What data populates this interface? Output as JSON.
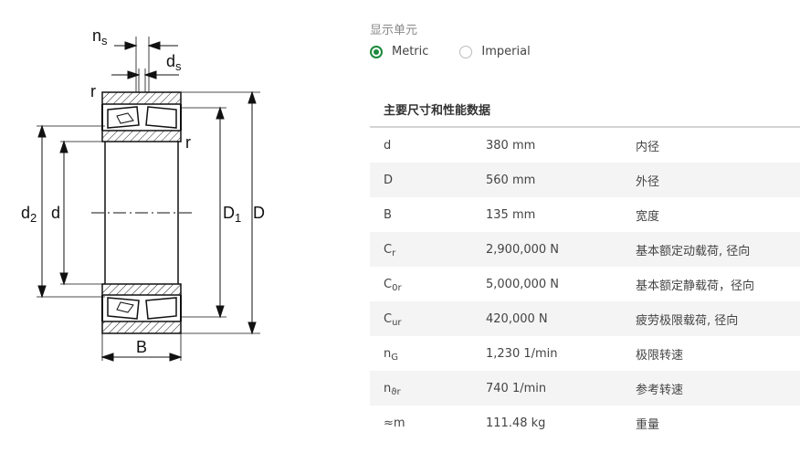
{
  "drawing": {
    "labels": {
      "ns": {
        "main": "n",
        "sub": "s"
      },
      "ds": {
        "main": "d",
        "sub": "s"
      },
      "r_top": "r",
      "r_right": "r",
      "d2": {
        "main": "d",
        "sub": "2"
      },
      "d": "d",
      "D1": {
        "main": "D",
        "sub": "1"
      },
      "D": "D",
      "B": "B"
    }
  },
  "units": {
    "label": "显示单元",
    "options": [
      {
        "label": "Metric",
        "selected": true
      },
      {
        "label": "Imperial",
        "selected": false
      }
    ]
  },
  "section_title": "主要尺寸和性能数据",
  "rows": [
    {
      "sym": "d",
      "sub": "",
      "value": "380 mm",
      "desc": "内径"
    },
    {
      "sym": "D",
      "sub": "",
      "value": "560 mm",
      "desc": "外径"
    },
    {
      "sym": "B",
      "sub": "",
      "value": "135 mm",
      "desc": "宽度"
    },
    {
      "sym": "C",
      "sub": "r",
      "value": "2,900,000 N",
      "desc": "基本额定动载荷, 径向"
    },
    {
      "sym": "C",
      "sub": "0r",
      "value": "5,000,000 N",
      "desc": "基本额定静载荷，径向"
    },
    {
      "sym": "C",
      "sub": "ur",
      "value": "420,000 N",
      "desc": "疲劳极限载荷, 径向"
    },
    {
      "sym": "n",
      "sub": "G",
      "value": "1,230 1/min",
      "desc": "极限转速"
    },
    {
      "sym": "n",
      "sub": "ϑr",
      "value": "740 1/min",
      "desc": "参考转速"
    },
    {
      "sym": "≈m",
      "sub": "",
      "value": "111.48 kg",
      "desc": "重量"
    }
  ]
}
